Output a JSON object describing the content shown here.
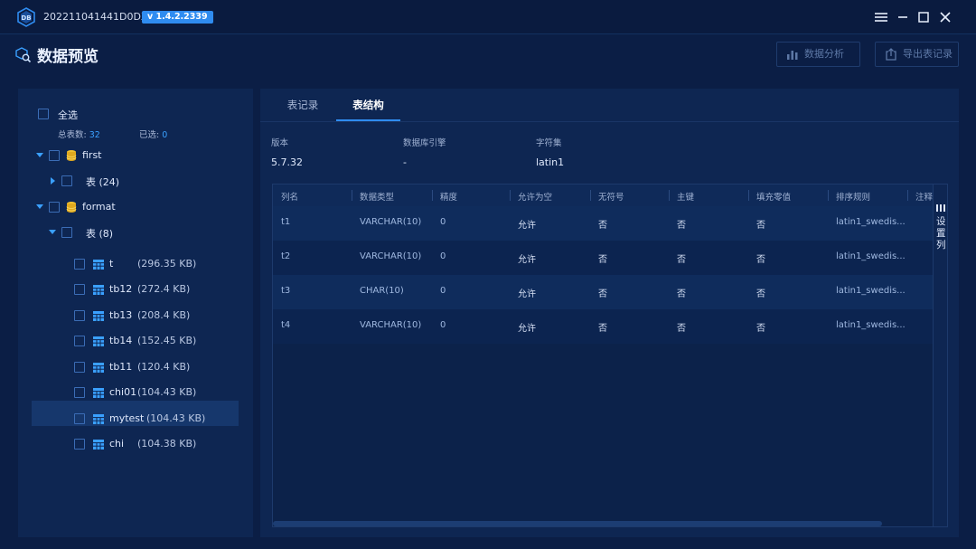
{
  "window": {
    "app_id": "202211041441D0DX",
    "version": "v 1.4.2.2339"
  },
  "header": {
    "title": "数据预览",
    "btn_analysis": "数据分析",
    "btn_export": "导出表记录"
  },
  "tree": {
    "select_all": "全选",
    "total_label": "总表数:",
    "total_value": "32",
    "selected_label": "已选:",
    "selected_value": "0",
    "databases": [
      {
        "name": "first",
        "group_label": "表 (24)"
      },
      {
        "name": "format",
        "group_label": "表 (8)"
      }
    ],
    "tables": [
      {
        "name": "t",
        "size": "(296.35 KB)"
      },
      {
        "name": "tb12",
        "size": "(272.4 KB)"
      },
      {
        "name": "tb13",
        "size": "(208.4 KB)"
      },
      {
        "name": "tb14",
        "size": "(152.45 KB)"
      },
      {
        "name": "tb11",
        "size": "(120.4 KB)"
      },
      {
        "name": "chi01",
        "size": "(104.43 KB)"
      },
      {
        "name": "mytest",
        "size": "(104.43 KB)"
      },
      {
        "name": "chi",
        "size": "(104.38 KB)"
      }
    ]
  },
  "tabs": {
    "records": "表记录",
    "structure": "表结构",
    "active": "structure"
  },
  "meta": {
    "version_label": "版本",
    "version_value": "5.7.32",
    "engine_label": "数据库引擎",
    "engine_value": "-",
    "charset_label": "字符集",
    "charset_value": "latin1"
  },
  "grid": {
    "headers": [
      "列名",
      "数据类型",
      "精度",
      "允许为空",
      "无符号",
      "主键",
      "填充零值",
      "排序规则",
      "注释"
    ],
    "rows": [
      [
        "t1",
        "VARCHAR(10)",
        "0",
        "允许",
        "否",
        "否",
        "否",
        "latin1_swedis..."
      ],
      [
        "t2",
        "VARCHAR(10)",
        "0",
        "允许",
        "否",
        "否",
        "否",
        "latin1_swedis..."
      ],
      [
        "t3",
        "CHAR(10)",
        "0",
        "允许",
        "否",
        "否",
        "否",
        "latin1_swedis..."
      ],
      [
        "t4",
        "VARCHAR(10)",
        "0",
        "允许",
        "否",
        "否",
        "否",
        "latin1_swedis..."
      ]
    ],
    "settings_label": "设置列"
  },
  "colors": {
    "accent": "#2f8cf0",
    "bg": "#0b1e45",
    "panel": "#0e2652",
    "highlight": "#16376c"
  }
}
